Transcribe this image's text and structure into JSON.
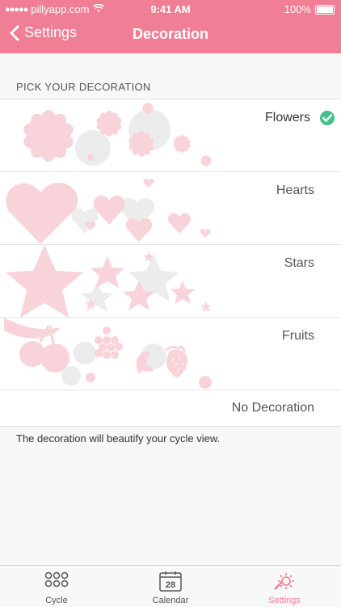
{
  "status_bar": {
    "carrier": "pillyapp.com",
    "time": "9:41 AM",
    "battery": "100%"
  },
  "nav": {
    "back_label": "Settings",
    "title": "Decoration"
  },
  "section_header": "PICK YOUR DECORATION",
  "decorations": [
    {
      "label": "Flowers",
      "selected": true
    },
    {
      "label": "Hearts",
      "selected": false
    },
    {
      "label": "Stars",
      "selected": false
    },
    {
      "label": "Fruits",
      "selected": false
    },
    {
      "label": "No Decoration",
      "selected": false
    }
  ],
  "footnote": "The decoration will beautify your cycle view.",
  "tabs": [
    {
      "label": "Cycle",
      "icon": "cycle-icon",
      "active": false
    },
    {
      "label": "Calendar",
      "icon": "calendar-icon",
      "badge": "28",
      "active": false
    },
    {
      "label": "Settings",
      "icon": "settings-icon",
      "active": true
    }
  ],
  "colors": {
    "accent": "#f07e94",
    "check": "#45c08a",
    "deco_pink": "#f9d3da",
    "deco_gray": "#ececec"
  }
}
